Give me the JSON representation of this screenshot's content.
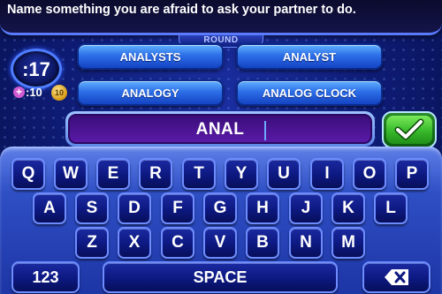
{
  "question": "Name something you are afraid to ask your partner to do.",
  "round_label": "ROUND",
  "timer": ":17",
  "bonus": {
    "plus_symbol": "+",
    "value": ":10",
    "coin_value": "10"
  },
  "answers": [
    "ANALYSTS",
    "ANALYST",
    "ANALOGY",
    "ANALOG CLOCK"
  ],
  "input": {
    "value": "ANAL"
  },
  "keyboard": {
    "row1": [
      "Q",
      "W",
      "E",
      "R",
      "T",
      "Y",
      "U",
      "I",
      "O",
      "P"
    ],
    "row2": [
      "A",
      "S",
      "D",
      "F",
      "G",
      "H",
      "J",
      "K",
      "L"
    ],
    "row3": [
      "Z",
      "X",
      "C",
      "V",
      "B",
      "N",
      "M"
    ],
    "numbers_label": "123",
    "space_label": "SPACE"
  },
  "icons": {
    "submit": "checkmark-icon",
    "backspace": "backspace-icon"
  },
  "colors": {
    "answer_tile": "#2d6fe8",
    "input_field": "#4a1490",
    "submit_button": "#3cbd2e",
    "key_face": "#0d1880",
    "key_border": "#6d8cff"
  }
}
